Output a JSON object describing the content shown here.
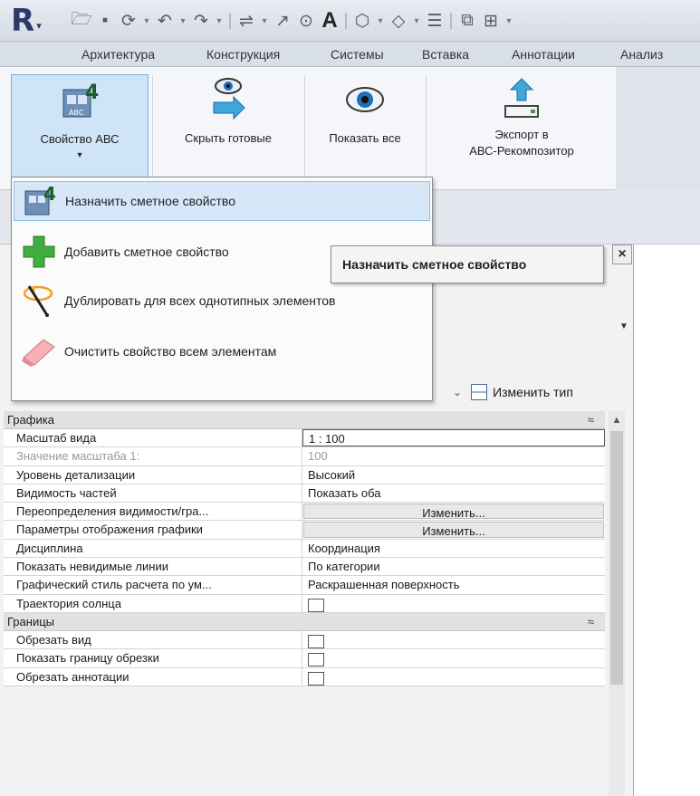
{
  "qat": {
    "app_logo": "R",
    "icons": [
      "open-icon",
      "save-icon",
      "sync-icon",
      "undo-icon",
      "redo-icon",
      "measure-icon",
      "dimension-icon",
      "tag-icon",
      "text-icon",
      "3d-view-icon",
      "section-icon",
      "thin-lines-icon",
      "close-views-icon",
      "switch-windows-icon"
    ],
    "text_tool_label": "A"
  },
  "tabs": [
    "Архитектура",
    "Конструкция",
    "Системы",
    "Вставка",
    "Аннотации",
    "Анализ"
  ],
  "ribbon": {
    "buttons": [
      {
        "label": "Свойство АВС",
        "has_dropdown": true,
        "icon": "abc-property-icon"
      },
      {
        "label": "Скрыть готовые",
        "icon": "hide-eye-icon"
      },
      {
        "label": "Показать все",
        "icon": "eye-icon"
      },
      {
        "label_line1": "Экспорт в",
        "label_line2": "АВС-Рекомпозитор",
        "icon": "export-icon"
      }
    ]
  },
  "menu": {
    "items": [
      {
        "label": "Назначить сметное свойство",
        "icon": "assign-icon",
        "highlighted": true
      },
      {
        "label": "Добавить сметное свойство",
        "icon": "plus-icon"
      },
      {
        "label": "Дублировать для всех однотипных элементов",
        "icon": "duplicate-icon"
      },
      {
        "label": "Очистить свойство всем элементам",
        "icon": "eraser-icon"
      }
    ]
  },
  "tooltip": {
    "text": "Назначить сметное свойство"
  },
  "palette": {
    "close_label": "×",
    "edit_type_label": "Изменить тип",
    "groups": [
      {
        "name": "Графика",
        "rows": [
          {
            "key": "Масштаб вида",
            "value": "1 : 100",
            "kind": "field"
          },
          {
            "key": "Значение масштаба    1:",
            "value": "100",
            "kind": "dim"
          },
          {
            "key": "Уровень детализации",
            "value": "Высокий"
          },
          {
            "key": "Видимость частей",
            "value": "Показать оба"
          },
          {
            "key": "Переопределения видимости/гра...",
            "value": "Изменить...",
            "kind": "button"
          },
          {
            "key": "Параметры отображения графики",
            "value": "Изменить...",
            "kind": "button"
          },
          {
            "key": "Дисциплина",
            "value": "Координация"
          },
          {
            "key": "Показать невидимые линии",
            "value": "По категории"
          },
          {
            "key": "Графический стиль расчета по ум...",
            "value": "Раскрашенная поверхность"
          },
          {
            "key": "Траектория солнца",
            "value": "",
            "kind": "checkbox"
          }
        ]
      },
      {
        "name": "Границы",
        "rows": [
          {
            "key": "Обрезать вид",
            "value": "",
            "kind": "checkbox"
          },
          {
            "key": "Показать границу обрезки",
            "value": "",
            "kind": "checkbox"
          },
          {
            "key": "Обрезать аннотации",
            "value": "",
            "kind": "checkbox"
          }
        ]
      }
    ]
  },
  "colors": {
    "accent": "#cfe4f7",
    "highlight_border": "#8fbde8",
    "tab_bar": "#d9dfe7"
  }
}
